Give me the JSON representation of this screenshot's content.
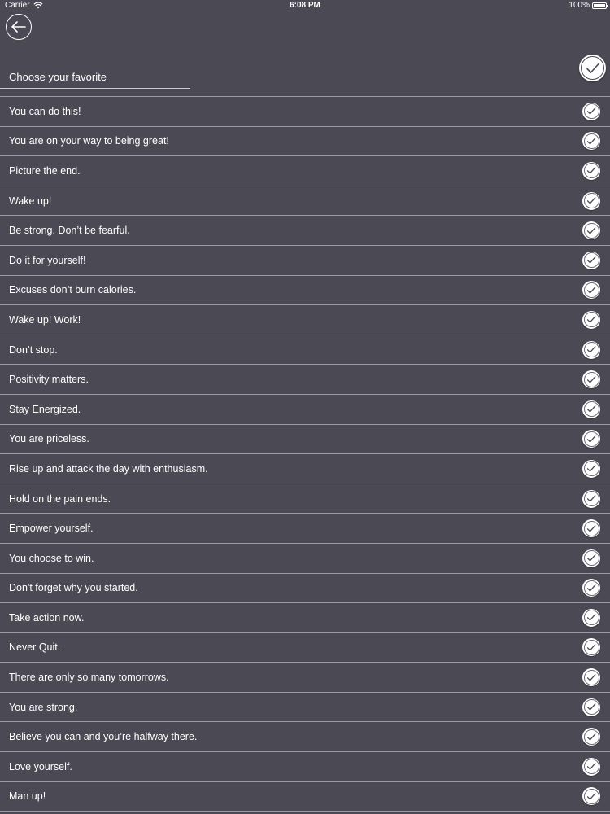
{
  "status_bar": {
    "carrier": "Carrier",
    "time": "6:08 PM",
    "battery": "100%"
  },
  "header": {
    "back_icon": "arrow-left-icon",
    "title": "Choose your favorite",
    "select_all_icon": "checkmark-icon"
  },
  "colors": {
    "background": "#4b4a54",
    "divider": "#9c9ba3",
    "text": "#ffffff"
  },
  "quotes": [
    "You can do this!",
    "You are on your way to being great!",
    "Picture the end.",
    "Wake up!",
    "Be strong. Don’t be fearful.",
    "Do it for yourself!",
    "Excuses don’t burn calories.",
    "Wake up! Work!",
    "Don’t stop.",
    "Positivity matters.",
    "Stay Energized.",
    "You are priceless.",
    "Rise up and attack the day with enthusiasm.",
    "Hold on the pain ends.",
    "Empower yourself.",
    "You choose to win.",
    "Don't forget why you started.",
    "Take action now.",
    "Never Quit.",
    "There are only so many tomorrows.",
    "You are strong.",
    "Believe you can and you’re halfway there.",
    "Love yourself.",
    "Man up!"
  ]
}
